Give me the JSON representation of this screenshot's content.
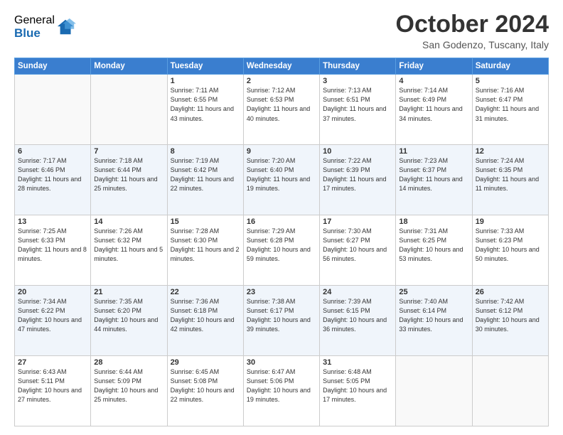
{
  "logo": {
    "general": "General",
    "blue": "Blue"
  },
  "title": "October 2024",
  "location": "San Godenzo, Tuscany, Italy",
  "days_of_week": [
    "Sunday",
    "Monday",
    "Tuesday",
    "Wednesday",
    "Thursday",
    "Friday",
    "Saturday"
  ],
  "weeks": [
    [
      {
        "day": "",
        "sunrise": "",
        "sunset": "",
        "daylight": ""
      },
      {
        "day": "",
        "sunrise": "",
        "sunset": "",
        "daylight": ""
      },
      {
        "day": "1",
        "sunrise": "Sunrise: 7:11 AM",
        "sunset": "Sunset: 6:55 PM",
        "daylight": "Daylight: 11 hours and 43 minutes."
      },
      {
        "day": "2",
        "sunrise": "Sunrise: 7:12 AM",
        "sunset": "Sunset: 6:53 PM",
        "daylight": "Daylight: 11 hours and 40 minutes."
      },
      {
        "day": "3",
        "sunrise": "Sunrise: 7:13 AM",
        "sunset": "Sunset: 6:51 PM",
        "daylight": "Daylight: 11 hours and 37 minutes."
      },
      {
        "day": "4",
        "sunrise": "Sunrise: 7:14 AM",
        "sunset": "Sunset: 6:49 PM",
        "daylight": "Daylight: 11 hours and 34 minutes."
      },
      {
        "day": "5",
        "sunrise": "Sunrise: 7:16 AM",
        "sunset": "Sunset: 6:47 PM",
        "daylight": "Daylight: 11 hours and 31 minutes."
      }
    ],
    [
      {
        "day": "6",
        "sunrise": "Sunrise: 7:17 AM",
        "sunset": "Sunset: 6:46 PM",
        "daylight": "Daylight: 11 hours and 28 minutes."
      },
      {
        "day": "7",
        "sunrise": "Sunrise: 7:18 AM",
        "sunset": "Sunset: 6:44 PM",
        "daylight": "Daylight: 11 hours and 25 minutes."
      },
      {
        "day": "8",
        "sunrise": "Sunrise: 7:19 AM",
        "sunset": "Sunset: 6:42 PM",
        "daylight": "Daylight: 11 hours and 22 minutes."
      },
      {
        "day": "9",
        "sunrise": "Sunrise: 7:20 AM",
        "sunset": "Sunset: 6:40 PM",
        "daylight": "Daylight: 11 hours and 19 minutes."
      },
      {
        "day": "10",
        "sunrise": "Sunrise: 7:22 AM",
        "sunset": "Sunset: 6:39 PM",
        "daylight": "Daylight: 11 hours and 17 minutes."
      },
      {
        "day": "11",
        "sunrise": "Sunrise: 7:23 AM",
        "sunset": "Sunset: 6:37 PM",
        "daylight": "Daylight: 11 hours and 14 minutes."
      },
      {
        "day": "12",
        "sunrise": "Sunrise: 7:24 AM",
        "sunset": "Sunset: 6:35 PM",
        "daylight": "Daylight: 11 hours and 11 minutes."
      }
    ],
    [
      {
        "day": "13",
        "sunrise": "Sunrise: 7:25 AM",
        "sunset": "Sunset: 6:33 PM",
        "daylight": "Daylight: 11 hours and 8 minutes."
      },
      {
        "day": "14",
        "sunrise": "Sunrise: 7:26 AM",
        "sunset": "Sunset: 6:32 PM",
        "daylight": "Daylight: 11 hours and 5 minutes."
      },
      {
        "day": "15",
        "sunrise": "Sunrise: 7:28 AM",
        "sunset": "Sunset: 6:30 PM",
        "daylight": "Daylight: 11 hours and 2 minutes."
      },
      {
        "day": "16",
        "sunrise": "Sunrise: 7:29 AM",
        "sunset": "Sunset: 6:28 PM",
        "daylight": "Daylight: 10 hours and 59 minutes."
      },
      {
        "day": "17",
        "sunrise": "Sunrise: 7:30 AM",
        "sunset": "Sunset: 6:27 PM",
        "daylight": "Daylight: 10 hours and 56 minutes."
      },
      {
        "day": "18",
        "sunrise": "Sunrise: 7:31 AM",
        "sunset": "Sunset: 6:25 PM",
        "daylight": "Daylight: 10 hours and 53 minutes."
      },
      {
        "day": "19",
        "sunrise": "Sunrise: 7:33 AM",
        "sunset": "Sunset: 6:23 PM",
        "daylight": "Daylight: 10 hours and 50 minutes."
      }
    ],
    [
      {
        "day": "20",
        "sunrise": "Sunrise: 7:34 AM",
        "sunset": "Sunset: 6:22 PM",
        "daylight": "Daylight: 10 hours and 47 minutes."
      },
      {
        "day": "21",
        "sunrise": "Sunrise: 7:35 AM",
        "sunset": "Sunset: 6:20 PM",
        "daylight": "Daylight: 10 hours and 44 minutes."
      },
      {
        "day": "22",
        "sunrise": "Sunrise: 7:36 AM",
        "sunset": "Sunset: 6:18 PM",
        "daylight": "Daylight: 10 hours and 42 minutes."
      },
      {
        "day": "23",
        "sunrise": "Sunrise: 7:38 AM",
        "sunset": "Sunset: 6:17 PM",
        "daylight": "Daylight: 10 hours and 39 minutes."
      },
      {
        "day": "24",
        "sunrise": "Sunrise: 7:39 AM",
        "sunset": "Sunset: 6:15 PM",
        "daylight": "Daylight: 10 hours and 36 minutes."
      },
      {
        "day": "25",
        "sunrise": "Sunrise: 7:40 AM",
        "sunset": "Sunset: 6:14 PM",
        "daylight": "Daylight: 10 hours and 33 minutes."
      },
      {
        "day": "26",
        "sunrise": "Sunrise: 7:42 AM",
        "sunset": "Sunset: 6:12 PM",
        "daylight": "Daylight: 10 hours and 30 minutes."
      }
    ],
    [
      {
        "day": "27",
        "sunrise": "Sunrise: 6:43 AM",
        "sunset": "Sunset: 5:11 PM",
        "daylight": "Daylight: 10 hours and 27 minutes."
      },
      {
        "day": "28",
        "sunrise": "Sunrise: 6:44 AM",
        "sunset": "Sunset: 5:09 PM",
        "daylight": "Daylight: 10 hours and 25 minutes."
      },
      {
        "day": "29",
        "sunrise": "Sunrise: 6:45 AM",
        "sunset": "Sunset: 5:08 PM",
        "daylight": "Daylight: 10 hours and 22 minutes."
      },
      {
        "day": "30",
        "sunrise": "Sunrise: 6:47 AM",
        "sunset": "Sunset: 5:06 PM",
        "daylight": "Daylight: 10 hours and 19 minutes."
      },
      {
        "day": "31",
        "sunrise": "Sunrise: 6:48 AM",
        "sunset": "Sunset: 5:05 PM",
        "daylight": "Daylight: 10 hours and 17 minutes."
      },
      {
        "day": "",
        "sunrise": "",
        "sunset": "",
        "daylight": ""
      },
      {
        "day": "",
        "sunrise": "",
        "sunset": "",
        "daylight": ""
      }
    ]
  ]
}
